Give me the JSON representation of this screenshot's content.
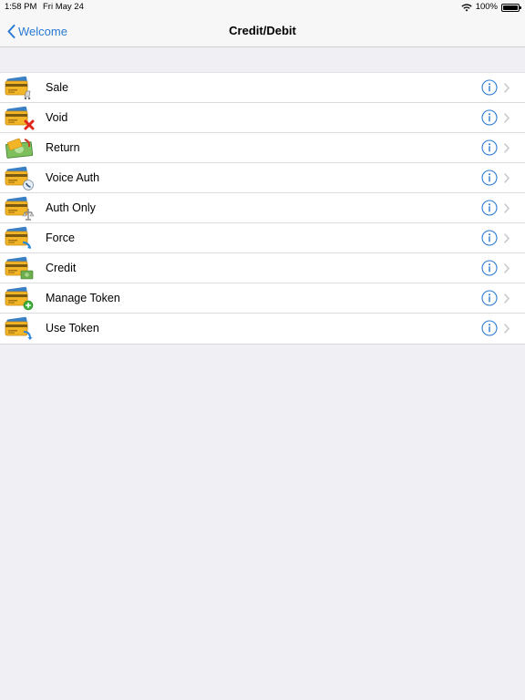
{
  "status_bar": {
    "time": "1:58 PM",
    "date": "Fri May 24",
    "battery": "100%"
  },
  "nav": {
    "back_label": "Welcome",
    "title": "Credit/Debit"
  },
  "colors": {
    "accent": "#2a7ad3",
    "background": "#efeff4",
    "chevron": "#c7c7cc"
  },
  "menu": [
    {
      "label": "Sale",
      "icon": "card-sale-icon"
    },
    {
      "label": "Void",
      "icon": "card-void-icon"
    },
    {
      "label": "Return",
      "icon": "return-money-icon"
    },
    {
      "label": "Voice Auth",
      "icon": "card-phone-icon"
    },
    {
      "label": "Auth Only",
      "icon": "card-auth-icon"
    },
    {
      "label": "Force",
      "icon": "card-force-icon"
    },
    {
      "label": "Credit",
      "icon": "card-credit-icon"
    },
    {
      "label": "Manage Token",
      "icon": "card-add-token-icon"
    },
    {
      "label": "Use Token",
      "icon": "card-use-token-icon"
    }
  ]
}
